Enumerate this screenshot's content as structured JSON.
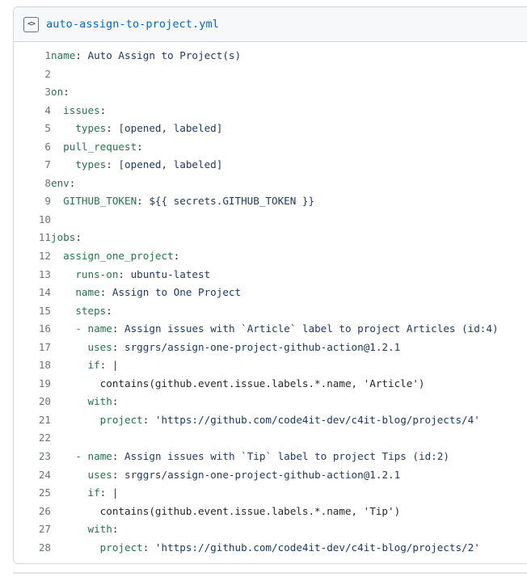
{
  "file": {
    "icon": "code-embed-icon",
    "name": "auto-assign-to-project.yml",
    "language": "yaml"
  },
  "colors": {
    "link": "#0366d6",
    "header_bg": "#f6f8fa",
    "border": "#d1d5da",
    "line_number": "#6a737d",
    "key": "#21764c",
    "value": "#1f3a68",
    "string": "#1b3a6b",
    "text": "#24292e"
  },
  "code": {
    "first_line_number": 1,
    "last_line_number": 28,
    "lines": [
      {
        "n": "1",
        "tokens": [
          {
            "t": "name",
            "c": "key"
          },
          {
            "t": ":",
            "c": "punct"
          },
          {
            "t": " Auto Assign to Project(s)",
            "c": "val"
          }
        ]
      },
      {
        "n": "2",
        "tokens": []
      },
      {
        "n": "3",
        "tokens": [
          {
            "t": "on",
            "c": "key"
          },
          {
            "t": ":",
            "c": "punct"
          }
        ]
      },
      {
        "n": "4",
        "tokens": [
          {
            "t": "  ",
            "c": "plain"
          },
          {
            "t": "issues",
            "c": "key"
          },
          {
            "t": ":",
            "c": "punct"
          }
        ]
      },
      {
        "n": "5",
        "tokens": [
          {
            "t": "    ",
            "c": "plain"
          },
          {
            "t": "types",
            "c": "key"
          },
          {
            "t": ":",
            "c": "punct"
          },
          {
            "t": " [opened, labeled]",
            "c": "val"
          }
        ]
      },
      {
        "n": "6",
        "tokens": [
          {
            "t": "  ",
            "c": "plain"
          },
          {
            "t": "pull_request",
            "c": "key"
          },
          {
            "t": ":",
            "c": "punct"
          }
        ]
      },
      {
        "n": "7",
        "tokens": [
          {
            "t": "    ",
            "c": "plain"
          },
          {
            "t": "types",
            "c": "key"
          },
          {
            "t": ":",
            "c": "punct"
          },
          {
            "t": " [opened, labeled]",
            "c": "val"
          }
        ]
      },
      {
        "n": "8",
        "tokens": [
          {
            "t": "env",
            "c": "key"
          },
          {
            "t": ":",
            "c": "punct"
          }
        ]
      },
      {
        "n": "9",
        "tokens": [
          {
            "t": "  ",
            "c": "plain"
          },
          {
            "t": "GITHUB_TOKEN",
            "c": "key"
          },
          {
            "t": ":",
            "c": "punct"
          },
          {
            "t": " ${{ secrets.GITHUB_TOKEN }}",
            "c": "val"
          }
        ]
      },
      {
        "n": "10",
        "tokens": []
      },
      {
        "n": "11",
        "tokens": [
          {
            "t": "jobs",
            "c": "key"
          },
          {
            "t": ":",
            "c": "punct"
          }
        ]
      },
      {
        "n": "12",
        "tokens": [
          {
            "t": "  ",
            "c": "plain"
          },
          {
            "t": "assign_one_project",
            "c": "key"
          },
          {
            "t": ":",
            "c": "punct"
          }
        ]
      },
      {
        "n": "13",
        "tokens": [
          {
            "t": "    ",
            "c": "plain"
          },
          {
            "t": "runs-on",
            "c": "key"
          },
          {
            "t": ":",
            "c": "punct"
          },
          {
            "t": " ubuntu-latest",
            "c": "val"
          }
        ]
      },
      {
        "n": "14",
        "tokens": [
          {
            "t": "    ",
            "c": "plain"
          },
          {
            "t": "name",
            "c": "key"
          },
          {
            "t": ":",
            "c": "punct"
          },
          {
            "t": " Assign to One Project",
            "c": "val"
          }
        ]
      },
      {
        "n": "15",
        "tokens": [
          {
            "t": "    ",
            "c": "plain"
          },
          {
            "t": "steps",
            "c": "key"
          },
          {
            "t": ":",
            "c": "punct"
          }
        ]
      },
      {
        "n": "16",
        "tokens": [
          {
            "t": "    ",
            "c": "plain"
          },
          {
            "t": "-",
            "c": "dash"
          },
          {
            "t": " ",
            "c": "plain"
          },
          {
            "t": "name",
            "c": "key"
          },
          {
            "t": ":",
            "c": "punct"
          },
          {
            "t": " Assign issues with `Article` label to project Articles (id:4)",
            "c": "val"
          }
        ]
      },
      {
        "n": "17",
        "tokens": [
          {
            "t": "      ",
            "c": "plain"
          },
          {
            "t": "uses",
            "c": "key"
          },
          {
            "t": ":",
            "c": "punct"
          },
          {
            "t": " srggrs/assign-one-project-github-action@1.2.1",
            "c": "val"
          }
        ]
      },
      {
        "n": "18",
        "tokens": [
          {
            "t": "      ",
            "c": "plain"
          },
          {
            "t": "if",
            "c": "key"
          },
          {
            "t": ":",
            "c": "punct"
          },
          {
            "t": " |",
            "c": "val"
          }
        ]
      },
      {
        "n": "19",
        "tokens": [
          {
            "t": "        contains(github.event.issue.labels.*.name, 'Article')",
            "c": "plain"
          }
        ]
      },
      {
        "n": "20",
        "tokens": [
          {
            "t": "      ",
            "c": "plain"
          },
          {
            "t": "with",
            "c": "key"
          },
          {
            "t": ":",
            "c": "punct"
          }
        ]
      },
      {
        "n": "21",
        "tokens": [
          {
            "t": "        ",
            "c": "plain"
          },
          {
            "t": "project",
            "c": "key"
          },
          {
            "t": ":",
            "c": "punct"
          },
          {
            "t": " 'https://github.com/code4it-dev/c4it-blog/projects/4'",
            "c": "str"
          }
        ]
      },
      {
        "n": "22",
        "tokens": []
      },
      {
        "n": "23",
        "tokens": [
          {
            "t": "    ",
            "c": "plain"
          },
          {
            "t": "-",
            "c": "dash"
          },
          {
            "t": " ",
            "c": "plain"
          },
          {
            "t": "name",
            "c": "key"
          },
          {
            "t": ":",
            "c": "punct"
          },
          {
            "t": " Assign issues with `Tip` label to project Tips (id:2)",
            "c": "val"
          }
        ]
      },
      {
        "n": "24",
        "tokens": [
          {
            "t": "      ",
            "c": "plain"
          },
          {
            "t": "uses",
            "c": "key"
          },
          {
            "t": ":",
            "c": "punct"
          },
          {
            "t": " srggrs/assign-one-project-github-action@1.2.1",
            "c": "val"
          }
        ]
      },
      {
        "n": "25",
        "tokens": [
          {
            "t": "      ",
            "c": "plain"
          },
          {
            "t": "if",
            "c": "key"
          },
          {
            "t": ":",
            "c": "punct"
          },
          {
            "t": " |",
            "c": "val"
          }
        ]
      },
      {
        "n": "26",
        "tokens": [
          {
            "t": "        contains(github.event.issue.labels.*.name, 'Tip')",
            "c": "plain"
          }
        ]
      },
      {
        "n": "27",
        "tokens": [
          {
            "t": "      ",
            "c": "plain"
          },
          {
            "t": "with",
            "c": "key"
          },
          {
            "t": ":",
            "c": "punct"
          }
        ]
      },
      {
        "n": "28",
        "tokens": [
          {
            "t": "        ",
            "c": "plain"
          },
          {
            "t": "project",
            "c": "key"
          },
          {
            "t": ":",
            "c": "punct"
          },
          {
            "t": " 'https://github.com/code4it-dev/c4it-blog/projects/2'",
            "c": "str"
          }
        ]
      }
    ]
  }
}
